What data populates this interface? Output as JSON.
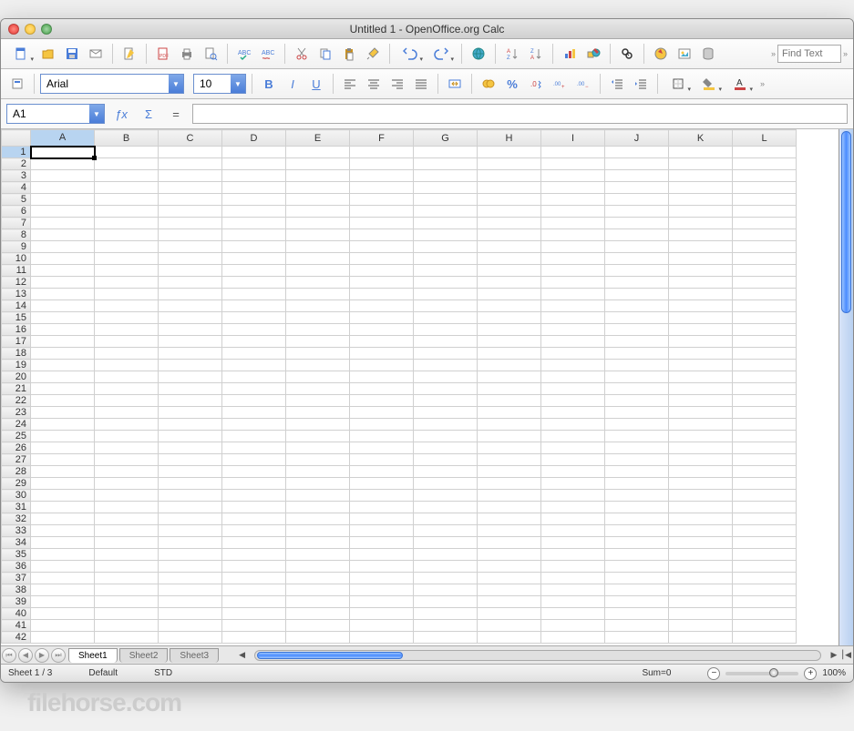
{
  "window": {
    "title": "Untitled 1 - OpenOffice.org Calc"
  },
  "toolbar1": {
    "find_placeholder": "Find Text"
  },
  "format": {
    "font_name": "Arial",
    "font_size": "10",
    "bold": "B",
    "italic": "I",
    "underline": "U"
  },
  "cellref": {
    "active": "A1",
    "fx": "ƒx",
    "sigma": "Σ",
    "eq": "=",
    "formula": ""
  },
  "columns": [
    "A",
    "B",
    "C",
    "D",
    "E",
    "F",
    "G",
    "H",
    "I",
    "J",
    "K",
    "L"
  ],
  "rows": [
    1,
    2,
    3,
    4,
    5,
    6,
    7,
    8,
    9,
    10,
    11,
    12,
    13,
    14,
    15,
    16,
    17,
    18,
    19,
    20,
    21,
    22,
    23,
    24,
    25,
    26,
    27,
    28,
    29,
    30,
    31,
    32,
    33,
    34,
    35,
    36,
    37,
    38,
    39,
    40,
    41,
    42
  ],
  "active_cell": {
    "row": 1,
    "col": "A"
  },
  "tabs": {
    "nav": [
      "⏮",
      "◀",
      "▶",
      "⏭"
    ],
    "sheets": [
      "Sheet1",
      "Sheet2",
      "Sheet3"
    ],
    "active": 0
  },
  "status": {
    "sheet": "Sheet 1 / 3",
    "style": "Default",
    "mode": "STD",
    "sum": "Sum=0",
    "zoom": "100%"
  },
  "watermark": "filehorse.com"
}
